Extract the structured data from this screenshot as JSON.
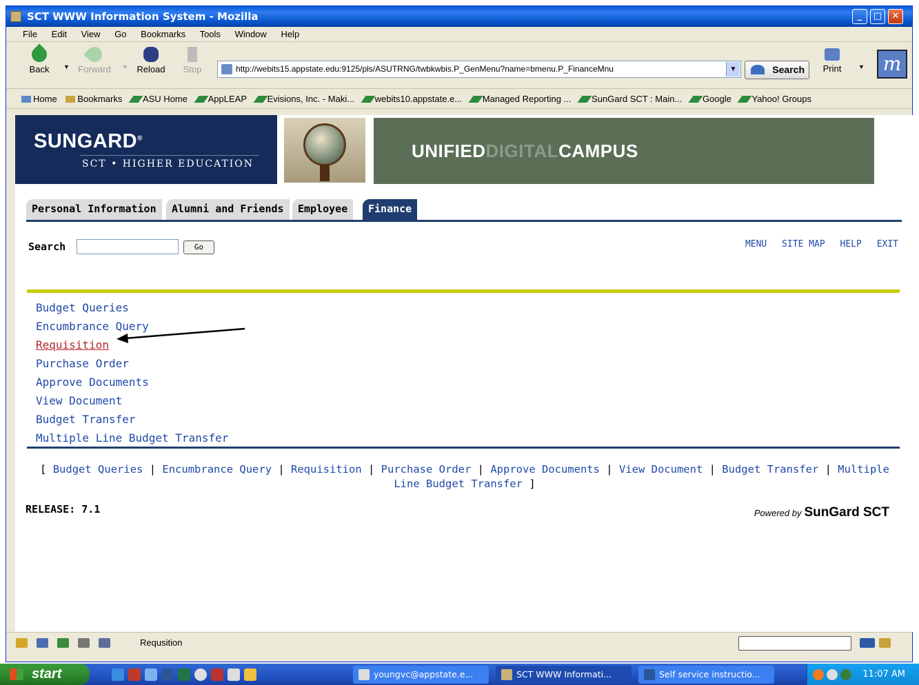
{
  "window": {
    "title": "SCT WWW Information System - Mozilla"
  },
  "menubar": [
    "File",
    "Edit",
    "View",
    "Go",
    "Bookmarks",
    "Tools",
    "Window",
    "Help"
  ],
  "navbar": {
    "back": "Back",
    "forward": "Forward",
    "reload": "Reload",
    "stop": "Stop",
    "url": "http://webits15.appstate.edu:9125/pls/ASUTRNG/twbkwbis.P_GenMenu?name=bmenu.P_FinanceMnu",
    "search": "Search",
    "print": "Print"
  },
  "bookmarks": [
    "Home",
    "Bookmarks",
    "ASU Home",
    "AppLEAP",
    "Evisions, Inc. - Maki...",
    "webits10.appstate.e...",
    "Managed Reporting ...",
    "SunGard SCT : Main...",
    "Google",
    "Yahoo! Groups"
  ],
  "banner": {
    "brand": "SUNGARD",
    "brand_sub": "SCT • HIGHER EDUCATION",
    "udc_a": "UNIFIED",
    "udc_b": "DIGITAL",
    "udc_c": "CAMPUS"
  },
  "tabs": [
    {
      "label": "Personal Information",
      "active": false
    },
    {
      "label": "Alumni and Friends",
      "active": false
    },
    {
      "label": "Employee",
      "active": false
    },
    {
      "label": "Finance",
      "active": true
    }
  ],
  "search": {
    "label": "Search",
    "value": "",
    "go": "Go"
  },
  "toplinks": [
    "MENU",
    "SITE MAP",
    "HELP",
    "EXIT"
  ],
  "menu_items": [
    "Budget Queries",
    "Encumbrance Query",
    "Requisition",
    "Purchase Order",
    "Approve Documents",
    "View Document",
    "Budget Transfer",
    "Multiple Line Budget Transfer"
  ],
  "footer_links": [
    "Budget Queries",
    "Encumbrance Query",
    "Requisition",
    "Purchase Order",
    "Approve Documents",
    "View Document",
    "Budget Transfer",
    "Multiple Line Budget Transfer"
  ],
  "release": "RELEASE: 7.1",
  "powered": {
    "by": "Powered by",
    "brand": "SunGard SCT"
  },
  "status": {
    "text": "Requsition"
  },
  "taskbar": {
    "start": "start",
    "tasks": [
      "youngvc@appstate.e...",
      "SCT WWW Informati...",
      "Self service instructio..."
    ],
    "clock": "11:07 AM"
  }
}
